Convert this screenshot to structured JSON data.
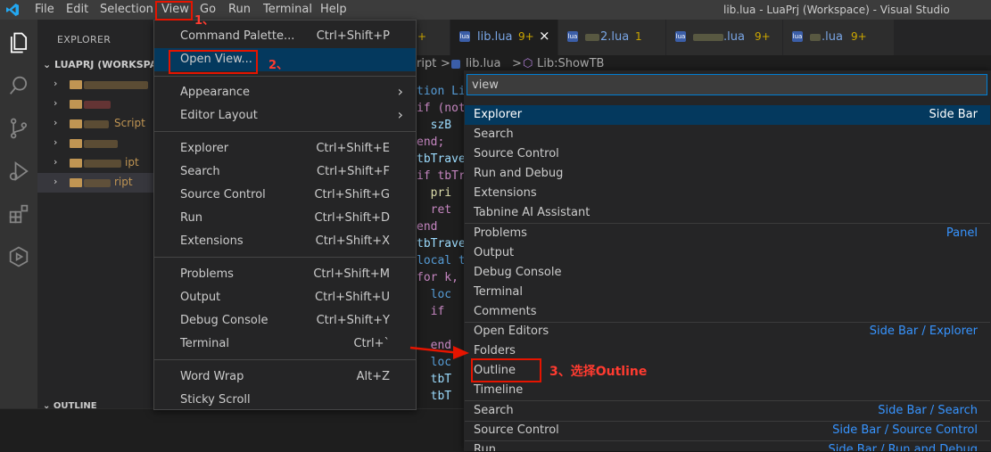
{
  "menubar": {
    "items": [
      "File",
      "Edit",
      "Selection",
      "View",
      "Go",
      "Run",
      "Terminal",
      "Help"
    ],
    "window_title": "lib.lua - LuaPrj (Workspace) - Visual Studio"
  },
  "explorer": {
    "title": "EXPLORER",
    "workspace": "LUAPRJ (WORKSPACE)",
    "fragments": [
      "Script",
      "ipt",
      "ript"
    ],
    "outline": "OUTLINE"
  },
  "tabs": [
    {
      "name": "lib.lua",
      "badge": "9+"
    },
    {
      "name": "2.lua",
      "badge": "1"
    },
    {
      "name": ".lua",
      "badge": "9+"
    },
    {
      "name": ".lua",
      "badge": "9+"
    }
  ],
  "breadcrumb": {
    "part1": "ript",
    "sep": ">",
    "file": "lib.lua",
    "symbol": "Lib:ShowTB"
  },
  "code_lines": [
    "tion Li",
    "if (not",
    "  szB",
    "end;",
    "tbTrave",
    "if tbTr",
    "  pri",
    "  ret",
    "end",
    "tbTrave",
    "local t",
    "for k,",
    "  loc",
    "  if",
    "",
    "  end",
    "  loc",
    "  tbT",
    "  tbT"
  ],
  "view_menu": {
    "groups": [
      [
        {
          "label": "Command Palette...",
          "shortcut": "Ctrl+Shift+P"
        },
        {
          "label": "Open View...",
          "shortcut": ""
        }
      ],
      [
        {
          "label": "Appearance",
          "shortcut": ""
        },
        {
          "label": "Editor Layout",
          "shortcut": ""
        }
      ],
      [
        {
          "label": "Explorer",
          "shortcut": "Ctrl+Shift+E"
        },
        {
          "label": "Search",
          "shortcut": "Ctrl+Shift+F"
        },
        {
          "label": "Source Control",
          "shortcut": "Ctrl+Shift+G"
        },
        {
          "label": "Run",
          "shortcut": "Ctrl+Shift+D"
        },
        {
          "label": "Extensions",
          "shortcut": "Ctrl+Shift+X"
        }
      ],
      [
        {
          "label": "Problems",
          "shortcut": "Ctrl+Shift+M"
        },
        {
          "label": "Output",
          "shortcut": "Ctrl+Shift+U"
        },
        {
          "label": "Debug Console",
          "shortcut": "Ctrl+Shift+Y"
        },
        {
          "label": "Terminal",
          "shortcut": "Ctrl+`"
        }
      ],
      [
        {
          "label": "Word Wrap",
          "shortcut": "Alt+Z"
        },
        {
          "label": "Sticky Scroll",
          "shortcut": ""
        }
      ]
    ]
  },
  "quick_open": {
    "input_value": "view ",
    "items": [
      {
        "label": "Explorer",
        "category": "Side Bar"
      },
      {
        "label": "Search",
        "category": ""
      },
      {
        "label": "Source Control",
        "category": ""
      },
      {
        "label": "Run and Debug",
        "category": ""
      },
      {
        "label": "Extensions",
        "category": ""
      },
      {
        "label": "Tabnine AI Assistant",
        "category": ""
      },
      {
        "label": "Problems",
        "category": "Panel"
      },
      {
        "label": "Output",
        "category": ""
      },
      {
        "label": "Debug Console",
        "category": ""
      },
      {
        "label": "Terminal",
        "category": ""
      },
      {
        "label": "Comments",
        "category": ""
      },
      {
        "label": "Open Editors",
        "category": "Side Bar / Explorer"
      },
      {
        "label": "Folders",
        "category": ""
      },
      {
        "label": "Outline",
        "category": ""
      },
      {
        "label": "Timeline",
        "category": ""
      },
      {
        "label": "Search",
        "category": "Side Bar / Search"
      },
      {
        "label": "Source Control",
        "category": "Side Bar / Source Control"
      },
      {
        "label": "Run",
        "category": "Side Bar / Run and Debug"
      }
    ]
  },
  "annotations": {
    "step1": "1、",
    "step2": "2、",
    "step3": "3、选择Outline"
  },
  "colors": {
    "accent": "#007fd4",
    "selection": "#04395e",
    "annotation_red": "#e51400"
  }
}
